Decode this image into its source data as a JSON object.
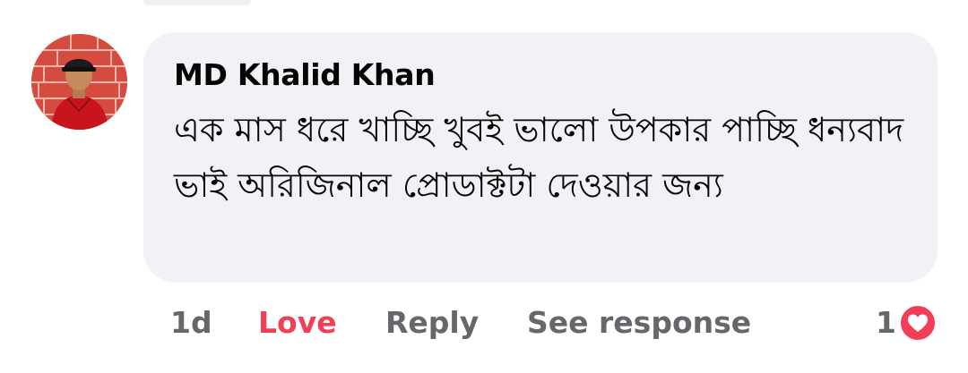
{
  "comment": {
    "author": "MD Khalid Khan",
    "text": "এক মাস ধরে খাচ্ছি খুবই ভালো উপকার পাচ্ছি ধন্যবাদ ভাই অরিজিনাল প্রোডাক্টটা দেওয়ার জন্য",
    "avatar_icon": "user-avatar-photo"
  },
  "actions": {
    "time": "1d",
    "love": "Love",
    "reply": "Reply",
    "see_response": "See response"
  },
  "reactions": {
    "count": "1",
    "icon": "heart-icon",
    "color": "#f33e58"
  },
  "colors": {
    "bubble": "#f0f2f5",
    "secondary_text": "#65676b",
    "love_active": "#f33e58"
  }
}
